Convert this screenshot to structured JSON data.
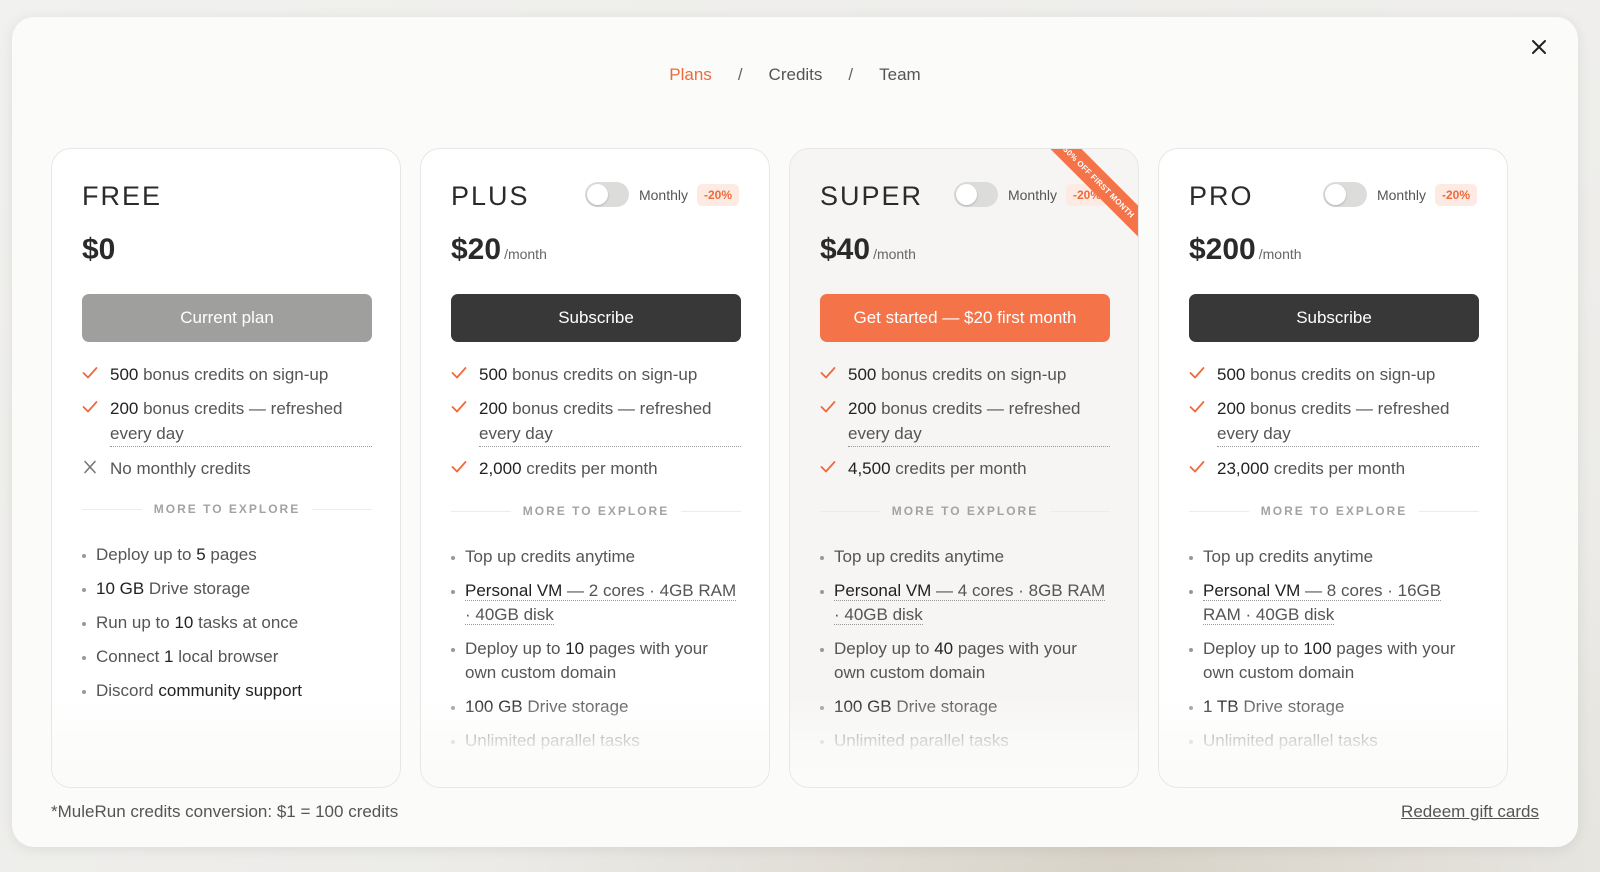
{
  "tabs": {
    "plans": "Plans",
    "credits": "Credits",
    "team": "Team",
    "separator": "/"
  },
  "colors": {
    "accent": "#ee6a3c",
    "dark_button": "#383838",
    "current_button": "#9f9f9e"
  },
  "plans": [
    {
      "name": "FREE",
      "price": "$0",
      "per": "",
      "cta": "Current plan",
      "features": [
        {
          "icon": "check-icon",
          "num": "500",
          "text": " bonus credits on sign-up"
        },
        {
          "icon": "check-icon",
          "num": "200",
          "text": " bonus credits — refreshed every day"
        },
        {
          "icon": "x-icon",
          "num": "",
          "text": "No monthly credits"
        }
      ],
      "more_label": "MORE TO EXPLORE",
      "more": [
        {
          "pre": "Deploy up to ",
          "bold": "5",
          "post": " pages"
        },
        {
          "pre": "",
          "bold": "10 GB",
          "post": " Drive storage"
        },
        {
          "pre": "Run up to ",
          "bold": "10",
          "post": " tasks at once"
        },
        {
          "pre": "Connect ",
          "bold": "1",
          "post": " local browser"
        },
        {
          "pre": "Discord ",
          "bold": "community support",
          "post": ""
        }
      ]
    },
    {
      "name": "PLUS",
      "toggle_label": "Monthly",
      "badge": "-20%",
      "price": "$20",
      "per": "/month",
      "cta": "Subscribe",
      "features": [
        {
          "icon": "check-icon",
          "num": "500",
          "text": " bonus credits on sign-up"
        },
        {
          "icon": "check-icon",
          "num": "200",
          "text": " bonus credits — refreshed every day"
        },
        {
          "icon": "check-icon",
          "num": "2,000",
          "text": " credits per month"
        }
      ],
      "more_label": "MORE TO EXPLORE",
      "more": [
        {
          "pre": "Top up credits anytime",
          "bold": "",
          "post": ""
        },
        {
          "pre": "",
          "bold": "Personal VM",
          "post": " — 2 cores · 4GB RAM · 40GB disk"
        },
        {
          "pre": "Deploy up to ",
          "bold": "10",
          "post": " pages with your own custom domain"
        },
        {
          "pre": "",
          "bold": "100 GB",
          "post": " Drive storage"
        },
        {
          "pre": "Unlimited parallel tasks",
          "bold": "",
          "post": ""
        }
      ]
    },
    {
      "name": "SUPER",
      "toggle_label": "Monthly",
      "badge": "-20%",
      "ribbon": "50% OFF FIRST MONTH",
      "price": "$40",
      "per": "/month",
      "cta": "Get started — $20 first month",
      "features": [
        {
          "icon": "check-icon",
          "num": "500",
          "text": " bonus credits on sign-up"
        },
        {
          "icon": "check-icon",
          "num": "200",
          "text": " bonus credits — refreshed every day"
        },
        {
          "icon": "check-icon",
          "num": "4,500",
          "text": " credits per month"
        }
      ],
      "more_label": "MORE TO EXPLORE",
      "more": [
        {
          "pre": "Top up credits anytime",
          "bold": "",
          "post": ""
        },
        {
          "pre": "",
          "bold": "Personal VM",
          "post": " — 4 cores · 8GB RAM · 40GB disk"
        },
        {
          "pre": "Deploy up to ",
          "bold": "40",
          "post": " pages with your own custom domain"
        },
        {
          "pre": "",
          "bold": "100 GB",
          "post": " Drive storage"
        },
        {
          "pre": "Unlimited parallel tasks",
          "bold": "",
          "post": ""
        }
      ]
    },
    {
      "name": "PRO",
      "toggle_label": "Monthly",
      "badge": "-20%",
      "price": "$200",
      "per": "/month",
      "cta": "Subscribe",
      "features": [
        {
          "icon": "check-icon",
          "num": "500",
          "text": " bonus credits on sign-up"
        },
        {
          "icon": "check-icon",
          "num": "200",
          "text": " bonus credits — refreshed every day"
        },
        {
          "icon": "check-icon",
          "num": "23,000",
          "text": " credits per month"
        }
      ],
      "more_label": "MORE TO EXPLORE",
      "more": [
        {
          "pre": "Top up credits anytime",
          "bold": "",
          "post": ""
        },
        {
          "pre": "",
          "bold": "Personal VM",
          "post": " — 8 cores · 16GB RAM · 40GB disk"
        },
        {
          "pre": "Deploy up to ",
          "bold": "100",
          "post": " pages with your own custom domain"
        },
        {
          "pre": "",
          "bold": "1 TB",
          "post": " Drive storage"
        },
        {
          "pre": "Unlimited parallel tasks",
          "bold": "",
          "post": ""
        }
      ]
    }
  ],
  "footer": {
    "note": "*MuleRun credits conversion: $1 = 100 credits",
    "redeem": "Redeem gift cards"
  }
}
